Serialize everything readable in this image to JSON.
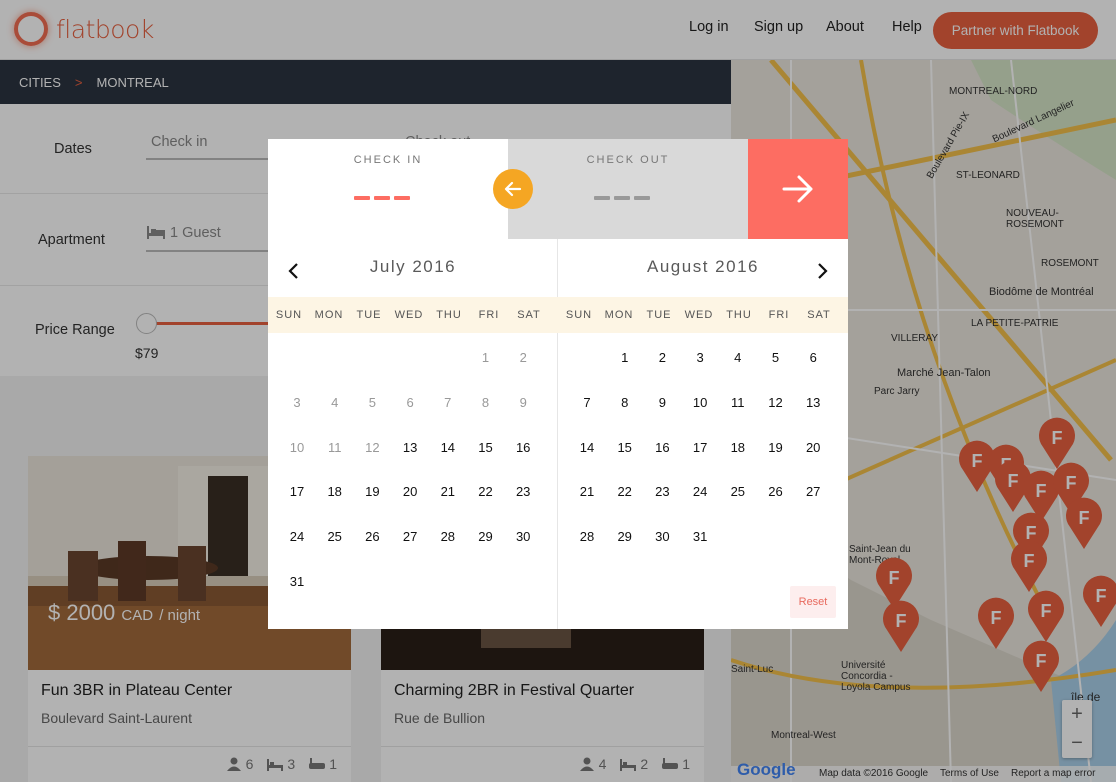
{
  "header": {
    "logo_text": "flatbook",
    "nav": [
      {
        "label": "Log in",
        "name": "nav-login"
      },
      {
        "label": "Sign up",
        "name": "nav-signup"
      },
      {
        "label": "About",
        "name": "nav-about"
      },
      {
        "label": "Help",
        "name": "nav-help"
      }
    ],
    "partner_label": "Partner with Flatbook"
  },
  "breadcrumb": {
    "cities": "CITIES",
    "separator": ">",
    "current": "MONTREAL"
  },
  "filters": {
    "dates_label": "Dates",
    "checkin_placeholder": "Check in",
    "checkout_placeholder": "Check out",
    "apartment_label": "Apartment",
    "guest_value": "1 Guest",
    "price_label": "Price Range",
    "price_min": "$79"
  },
  "listings": [
    {
      "title": "Fun 3BR in Plateau Center",
      "street": "Boulevard Saint-Laurent",
      "price": "$ 2000",
      "currency": "CAD",
      "period": "/ night",
      "guests": "6",
      "beds": "3",
      "baths": "1"
    },
    {
      "title": "Charming 2BR in Festival Quarter",
      "street": "Rue de Bullion",
      "guests": "4",
      "beds": "2",
      "baths": "1"
    }
  ],
  "datepicker": {
    "check_in_label": "CHECK IN",
    "check_out_label": "CHECK OUT",
    "reset_label": "Reset",
    "months": [
      {
        "title": "July 2016",
        "start": 5,
        "length": 31,
        "first_enabled": 13
      },
      {
        "title": "August 2016",
        "start": 1,
        "length": 31,
        "first_enabled": 1
      }
    ],
    "weekdays": [
      "SUN",
      "MON",
      "TUE",
      "WED",
      "THU",
      "FRI",
      "SAT"
    ]
  },
  "map": {
    "labels": [
      "MONTREAL-NORD",
      "ST-LEONARD",
      "NOUVEAU-ROSEMONT",
      "Biodôme de Montréal",
      "Marché Jean-Talon",
      "Parc Jarry",
      "VILLERAY",
      "Saint-Jean du Mont-Royal",
      "Saint-Luc",
      "Université Concordia - Loyola Campus",
      "Montreal-West",
      "Boulevard Langelier",
      "Boulevard Pie-IX",
      "LA PETITE-PATRIE",
      "ROSEMONT",
      "île de"
    ],
    "footer": {
      "google": "Google",
      "map_data": "Map data ©2016 Google",
      "terms": "Terms of Use",
      "report": "Report a map error"
    },
    "zoom_in": "+",
    "zoom_out": "−",
    "colors": {
      "pin": "#e8603f",
      "road": "#f4c14b"
    }
  },
  "colors": {
    "brand": "#e8603f",
    "accent_yellow": "#f5a623",
    "go": "#fd6d62",
    "breadcrumb_bg": "#2b3441"
  }
}
